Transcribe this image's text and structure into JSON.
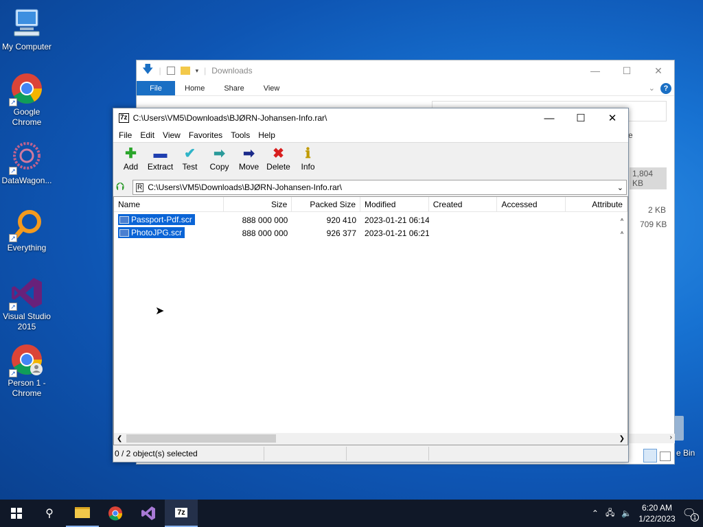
{
  "desktop": {
    "icons": [
      {
        "label": "My Computer",
        "icon": "computer-icon"
      },
      {
        "label": "Google Chrome",
        "icon": "chrome-icon"
      },
      {
        "label": "DataWagon...",
        "icon": "datawagon-icon"
      },
      {
        "label": "Everything",
        "icon": "everything-icon"
      },
      {
        "label": "Visual Studio 2015",
        "icon": "visual-studio-icon"
      },
      {
        "label": "Person 1 - Chrome",
        "icon": "chrome-profile-icon"
      }
    ],
    "recycle_label": "e Bin"
  },
  "explorer": {
    "title": "Downloads",
    "tabs": [
      "File",
      "Home",
      "Share",
      "View"
    ],
    "side_values": [
      "1,804 KB",
      "2 KB",
      "709 KB"
    ],
    "partial_text": "e"
  },
  "sevenzip": {
    "title": "C:\\Users\\VM5\\Downloads\\BJØRN-Johansen-Info.rar\\",
    "menu": [
      "File",
      "Edit",
      "View",
      "Favorites",
      "Tools",
      "Help"
    ],
    "toolbar": [
      {
        "label": "Add",
        "icon": "add-icon",
        "glyph": "✚",
        "color": "#2aa52a"
      },
      {
        "label": "Extract",
        "icon": "extract-icon",
        "glyph": "▬",
        "color": "#1f3fb0"
      },
      {
        "label": "Test",
        "icon": "test-icon",
        "glyph": "✔",
        "color": "#2fb4c8"
      },
      {
        "label": "Copy",
        "icon": "copy-icon",
        "glyph": "➡",
        "color": "#2a9a9a"
      },
      {
        "label": "Move",
        "icon": "move-icon",
        "glyph": "➡",
        "color": "#1a2a8a"
      },
      {
        "label": "Delete",
        "icon": "delete-icon",
        "glyph": "✖",
        "color": "#d81e1e"
      },
      {
        "label": "Info",
        "icon": "info-icon",
        "glyph": "ℹ",
        "color": "#c09a00"
      }
    ],
    "address": "C:\\Users\\VM5\\Downloads\\BJØRN-Johansen-Info.rar\\",
    "columns": [
      "Name",
      "Size",
      "Packed Size",
      "Modified",
      "Created",
      "Accessed",
      "Attribute"
    ],
    "files": [
      {
        "name": "Passport-Pdf.scr",
        "size": "888 000 000",
        "packed": "920 410",
        "modified": "2023-01-21 06:14",
        "created": "",
        "accessed": "",
        "attr": "A"
      },
      {
        "name": "PhotoJPG.scr",
        "size": "888 000 000",
        "packed": "926 377",
        "modified": "2023-01-21 06:21",
        "created": "",
        "accessed": "",
        "attr": "A"
      }
    ],
    "status": "0 / 2 object(s) selected"
  },
  "taskbar": {
    "time": "6:20 AM",
    "date": "1/22/2023",
    "notifications": "1"
  }
}
